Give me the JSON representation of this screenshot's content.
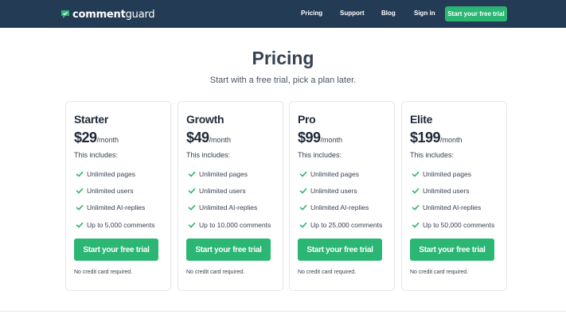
{
  "nav": {
    "logo_part1": "comment",
    "logo_part2": "guard",
    "links": [
      "Pricing",
      "Support",
      "Blog",
      "Sign in"
    ],
    "cta": "Start your free trial"
  },
  "hero": {
    "title": "Pricing",
    "subtitle": "Start with a free trial, pick a plan later."
  },
  "plans": [
    {
      "name": "Starter",
      "price": "$29",
      "period": "/month",
      "includes": "This includes:",
      "features": [
        "Unlimited pages",
        "Unlimited users",
        "Unlimited AI-replies",
        "Up to 5,000 comments"
      ],
      "cta": "Start your free trial",
      "note": "No credit card required."
    },
    {
      "name": "Growth",
      "price": "$49",
      "period": "/month",
      "includes": "This includes:",
      "features": [
        "Unlimited pages",
        "Unlimited users",
        "Unlimited AI-replies",
        "Up to 10,000 comments"
      ],
      "cta": "Start your free trial",
      "note": "No credit card required."
    },
    {
      "name": "Pro",
      "price": "$99",
      "period": "/month",
      "includes": "This includes:",
      "features": [
        "Unlimited pages",
        "Unlimited users",
        "Unlimited AI-replies",
        "Up to 25,000 comments"
      ],
      "cta": "Start your free trial",
      "note": "No credit card required."
    },
    {
      "name": "Elite",
      "price": "$199",
      "period": "/month",
      "includes": "This includes:",
      "features": [
        "Unlimited pages",
        "Unlimited users",
        "Unlimited AI-replies",
        "Up to 50,000 comments"
      ],
      "cta": "Start your free trial",
      "note": "No credit card required."
    }
  ],
  "colors": {
    "nav_bg": "#243b55",
    "accent": "#2bb673",
    "text": "#1f2937"
  },
  "icons": {
    "logo": "speech-bubble-shield-icon",
    "feature": "check-icon"
  }
}
